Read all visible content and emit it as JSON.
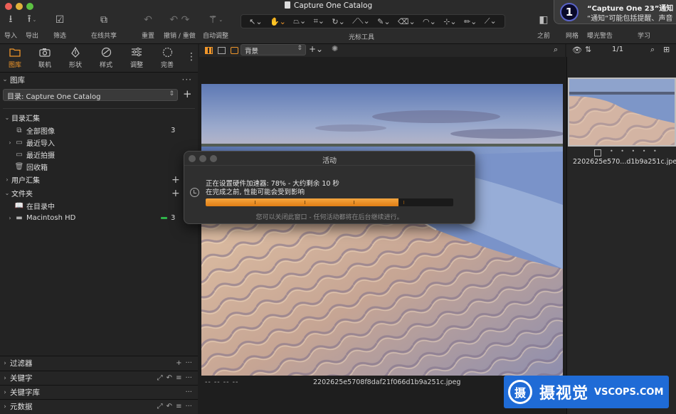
{
  "window": {
    "title": "Capture One Catalog"
  },
  "colors": {
    "accent": "#f0962a",
    "progress": "#ef8f22",
    "green_badge": "#2fb44a",
    "watermark": "#1f6bd6"
  },
  "toolbar": {
    "import": "导入",
    "export": "导出",
    "filter": "筛选",
    "share": "在线共享",
    "reset": "重置",
    "undo_redo": "撤销 / 重做",
    "auto_adjust": "自动调整",
    "cursor_tools": "光标工具",
    "before": "之前",
    "grid": "网格",
    "exposure_warning": "曝光警告",
    "learn": "学习"
  },
  "notification": {
    "title": "“Capture One 23”通知",
    "text": "“通知”可能包括提醒、声音",
    "badge": "1"
  },
  "tool_tabs": [
    {
      "label": "图库",
      "icon": "folder-icon"
    },
    {
      "label": "联机",
      "icon": "camera-icon"
    },
    {
      "label": "形状",
      "icon": "pen-icon"
    },
    {
      "label": "样式",
      "icon": "style-icon"
    },
    {
      "label": "调整",
      "icon": "sliders-icon"
    },
    {
      "label": "完善",
      "icon": "refine-icon"
    }
  ],
  "library": {
    "title": "图库",
    "catalog_select": "目录: Capture One Catalog",
    "collections_header": "目录汇集",
    "items": [
      {
        "label": "全部图像",
        "count": "3"
      },
      {
        "label": "最近导入",
        "count": ""
      },
      {
        "label": "最近拍摄",
        "count": ""
      },
      {
        "label": "回收箱",
        "count": ""
      }
    ],
    "user_collections": "用户汇集",
    "folders": "文件夹",
    "in_catalog": "在目录中",
    "macintosh_hd": "Macintosh HD",
    "macintosh_hd_count": "3"
  },
  "bottom_sections": [
    "过滤器",
    "关键字",
    "关键字库",
    "元数据"
  ],
  "viewer": {
    "background_select": "背景",
    "photo_meta": "-- -- -- --",
    "filename": "2202625e5708f8daf21f066d1b9a251c.jpeg"
  },
  "browser": {
    "count": "1/1",
    "thumb_name": "2202625e570...d1b9a251c.jpeg",
    "stars": "• • • • •"
  },
  "dialog": {
    "title": "活动",
    "line1": "正在设置硬件加速器: 78% - 大约剩余 10 秒",
    "line2": "在完成之前, 性能可能会受到影响",
    "progress": 0.78,
    "footer": "您可以关闭此窗口 - 任何活动都将在后台继续进行。"
  },
  "watermark": {
    "logo": "摄",
    "cn": "摄视觉",
    "en": "VSCOPS.COM"
  }
}
